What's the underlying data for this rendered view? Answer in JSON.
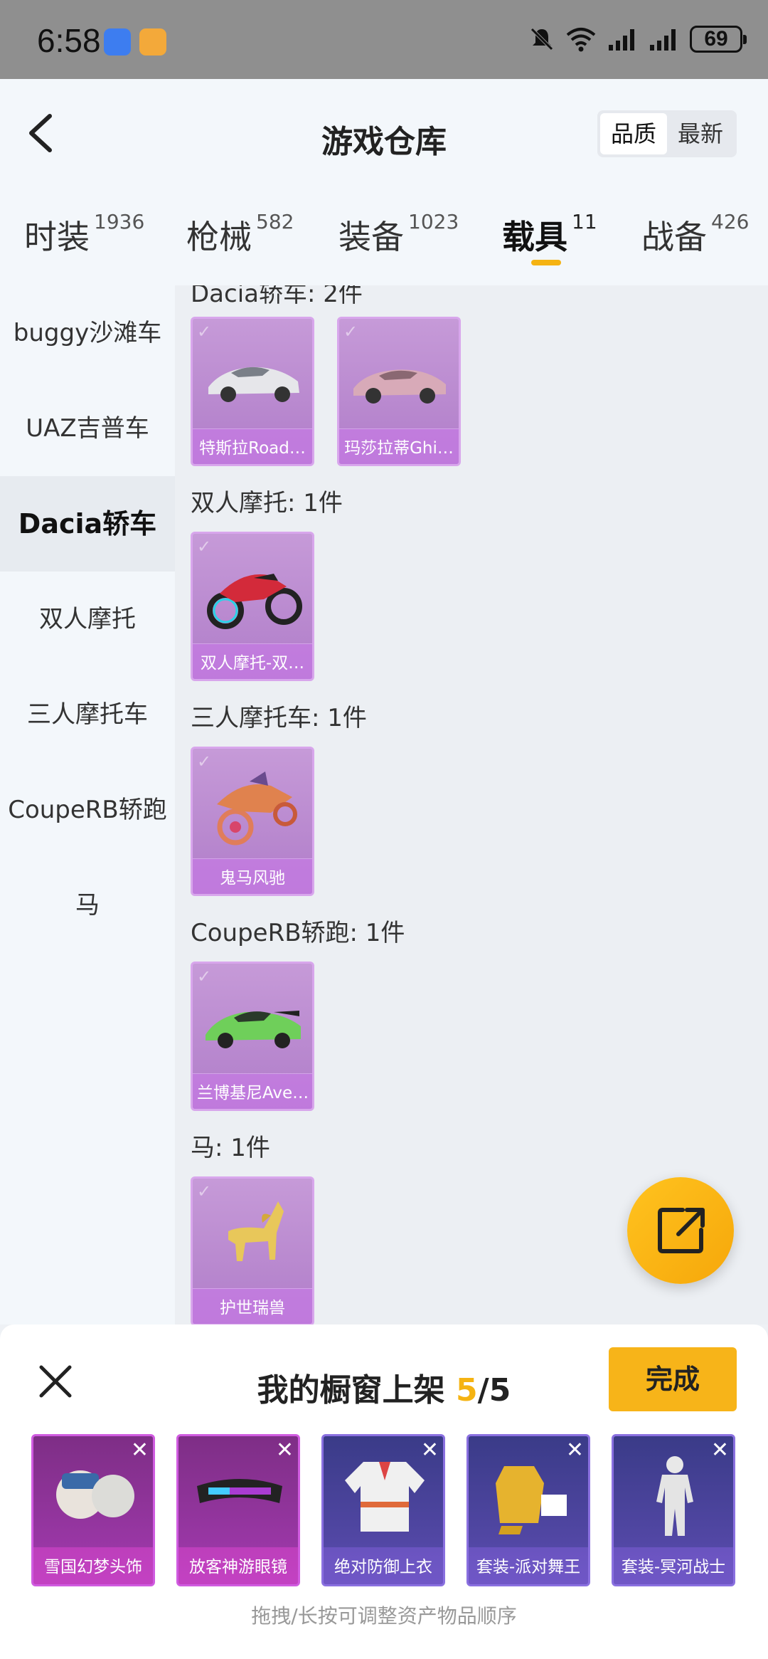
{
  "status_bar": {
    "time": "6:58",
    "battery": "69"
  },
  "header": {
    "title": "游戏仓库",
    "sort_options": [
      {
        "label": "品质",
        "active": true
      },
      {
        "label": "最新",
        "active": false
      }
    ]
  },
  "tabs": [
    {
      "label": "时装",
      "count": "1936"
    },
    {
      "label": "枪械",
      "count": "582"
    },
    {
      "label": "装备",
      "count": "1023"
    },
    {
      "label": "载具",
      "count": "11",
      "active": true
    },
    {
      "label": "战备",
      "count": "426"
    }
  ],
  "sidebar": [
    {
      "label": "buggy沙滩车"
    },
    {
      "label": "UAZ吉普车"
    },
    {
      "label": "Dacia轿车",
      "active": true
    },
    {
      "label": "双人摩托"
    },
    {
      "label": "三人摩托车"
    },
    {
      "label": "CoupeRB轿跑"
    },
    {
      "label": "马"
    }
  ],
  "sections": [
    {
      "title": "Dacia轿车: 2件",
      "items": [
        "特斯拉Road…",
        "玛莎拉蒂Ghi…"
      ]
    },
    {
      "title": "双人摩托: 1件",
      "items": [
        "双人摩托-双…"
      ]
    },
    {
      "title": "三人摩托车: 1件",
      "items": [
        "鬼马风驰"
      ]
    },
    {
      "title": "CoupeRB轿跑: 1件",
      "items": [
        "兰博基尼Ave…"
      ]
    },
    {
      "title": "马: 1件",
      "items": [
        "护世瑞兽"
      ]
    }
  ],
  "panel": {
    "title_prefix": "我的橱窗上架 ",
    "count": "5",
    "total": "/5",
    "done_label": "完成",
    "items": [
      {
        "label": "雪国幻梦头饰",
        "tint": "purple"
      },
      {
        "label": "放客神游眼镜",
        "tint": "purple"
      },
      {
        "label": "绝对防御上衣",
        "tint": "blue"
      },
      {
        "label": "套装-派对舞王",
        "tint": "blue"
      },
      {
        "label": "套装-冥河战士",
        "tint": "blue"
      }
    ],
    "hint": "拖拽/长按可调整资产物品顺序"
  }
}
